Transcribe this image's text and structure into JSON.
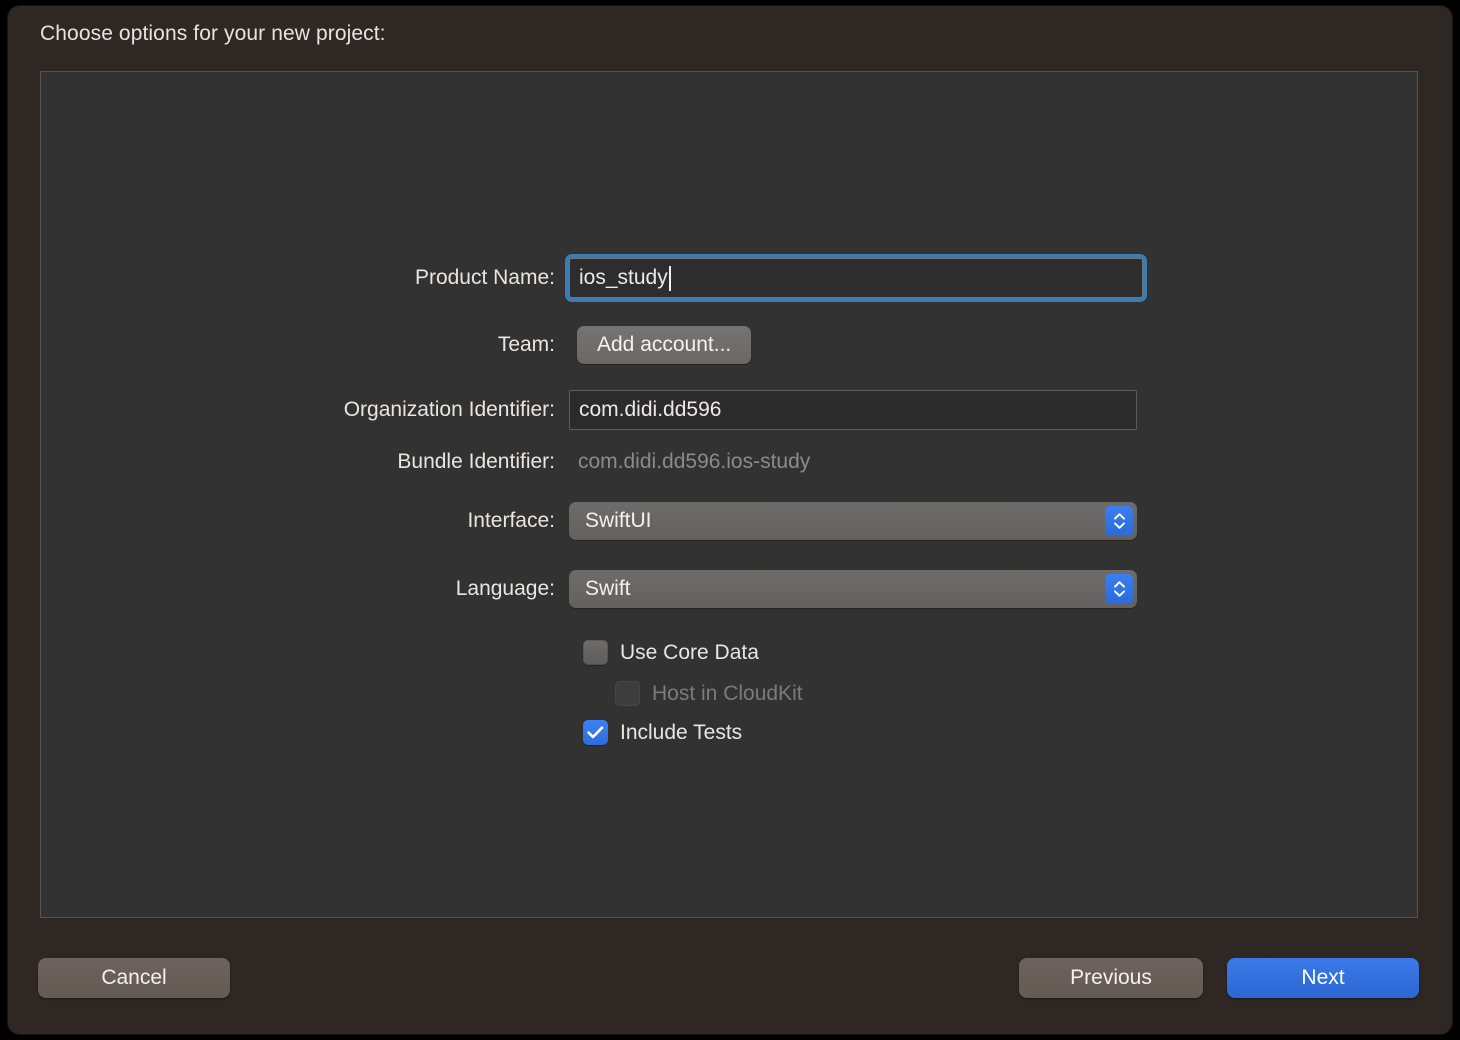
{
  "dialog": {
    "title": "Choose options for your new project:"
  },
  "form": {
    "product_name": {
      "label": "Product Name:",
      "value": "ios_study",
      "focused": true
    },
    "team": {
      "label": "Team:",
      "button_label": "Add account..."
    },
    "organization_identifier": {
      "label": "Organization Identifier:",
      "value": "com.didi.dd596"
    },
    "bundle_identifier": {
      "label": "Bundle Identifier:",
      "value": "com.didi.dd596.ios-study"
    },
    "interface": {
      "label": "Interface:",
      "value": "SwiftUI"
    },
    "language": {
      "label": "Language:",
      "value": "Swift"
    }
  },
  "checkboxes": {
    "use_core_data": {
      "label": "Use Core Data",
      "checked": false,
      "enabled": true
    },
    "host_in_cloudkit": {
      "label": "Host in CloudKit",
      "checked": false,
      "enabled": false
    },
    "include_tests": {
      "label": "Include Tests",
      "checked": true,
      "enabled": true
    }
  },
  "footer": {
    "cancel_label": "Cancel",
    "previous_label": "Previous",
    "next_label": "Next"
  },
  "colors": {
    "window_background": "#2f2723",
    "panel_background": "#323232",
    "accent_blue": "#3478f6",
    "focus_ring": "#3c7cb0",
    "default_button": "#2c67d4",
    "secondary_button": "#665b54",
    "disabled_text": "#7b7b7b"
  }
}
